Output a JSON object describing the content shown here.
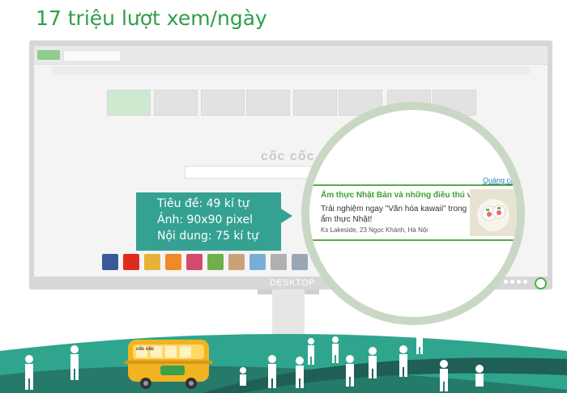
{
  "heading": "17 triệu lượt xem/ngày",
  "screen": {
    "logo_text": "cốc cốc"
  },
  "tooltip": {
    "lines": [
      "Tiêu đề: 49 kí tự",
      "Ảnh: 90x90 pixel",
      "Nội dung: 75 kí tự"
    ]
  },
  "ad": {
    "tag": "Quảng cáo",
    "title": "Ẩm thực Nhật Bản và những điều thú vị",
    "body": "Trải nghiệm ngay \"Văn hóa kawaii\" trong ẩm thực Nhật!",
    "address": "Ks Lakeside, 23 Ngọc Khánh, Hà Nội"
  },
  "monitor": {
    "label": "DESKTOP"
  },
  "bus": {
    "sign": "cốc cốc"
  },
  "colors": {
    "brand_green": "#2e9e4a",
    "tooltip_teal": "#35a193",
    "ground_teal": "#2fa58e"
  }
}
